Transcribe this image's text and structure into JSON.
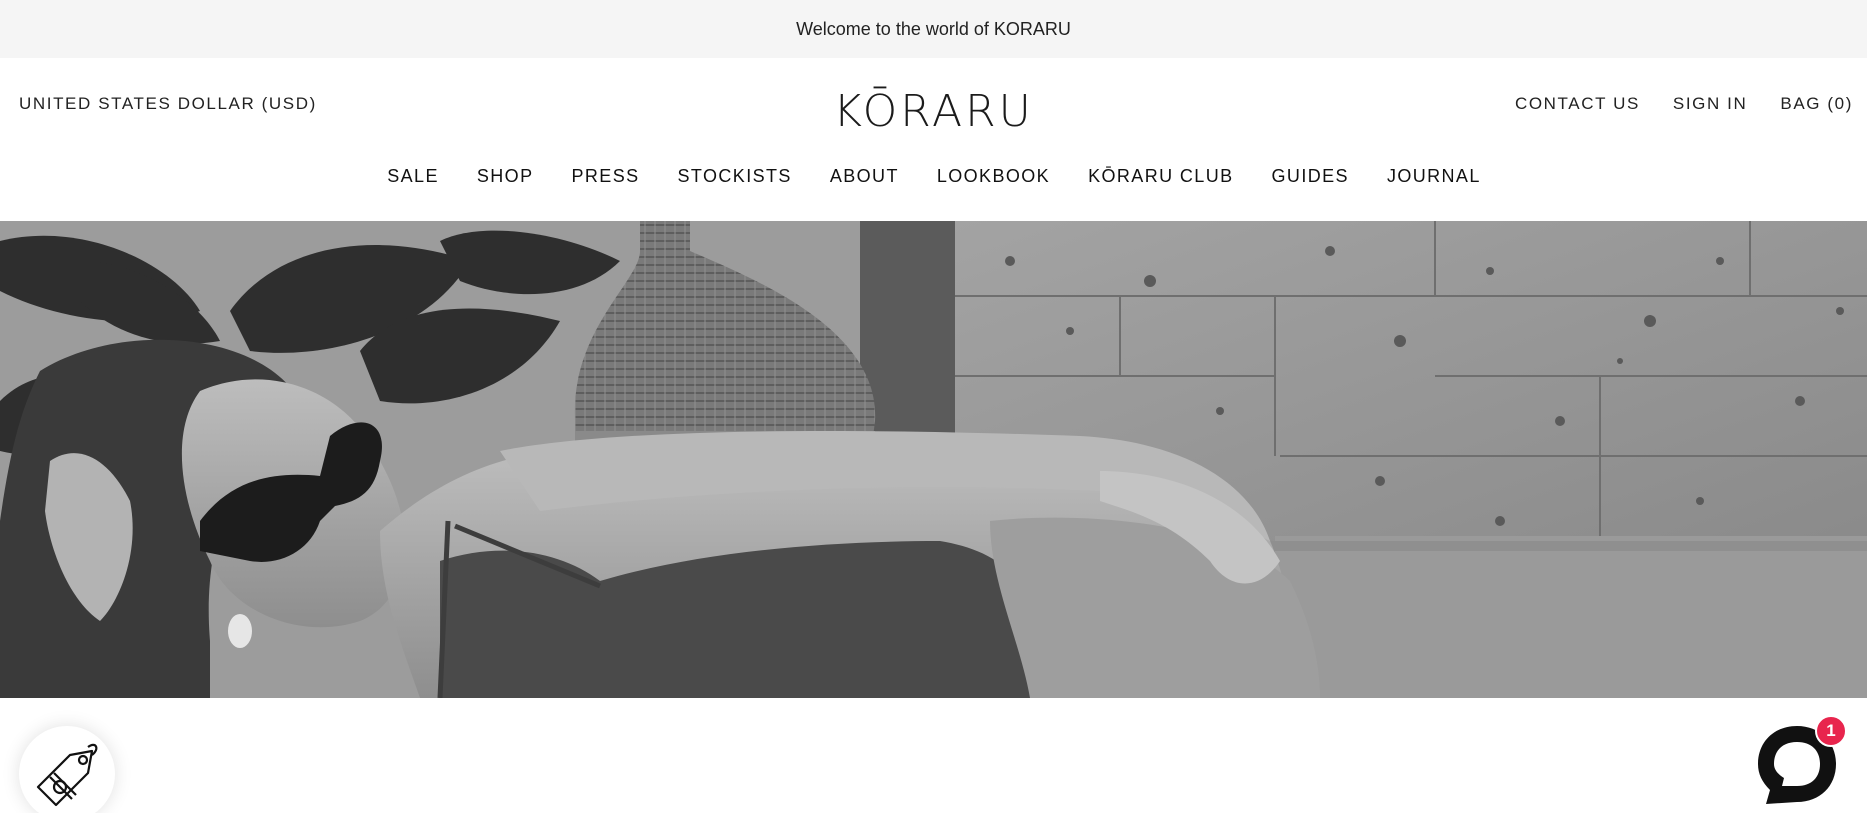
{
  "announcement": {
    "text": "Welcome to the world of KORARU"
  },
  "header": {
    "currency": "UNITED STATES DOLLAR (USD)",
    "logo": "KŌRARU",
    "utility_links": [
      "CONTACT US",
      "SIGN IN",
      "BAG (0)"
    ]
  },
  "nav": {
    "items": [
      "SALE",
      "SHOP",
      "PRESS",
      "STOCKISTS",
      "ABOUT",
      "LOOKBOOK",
      "KŌRARU CLUB",
      "GUIDES",
      "JOURNAL"
    ]
  },
  "hero": {
    "image": "black-and-white photo of woman in sunglasses and swimsuit reclining by stone wall"
  },
  "widgets": {
    "promo_icon": "price-tag-icon",
    "chat_icon": "chat-bubble-icon",
    "chat_badge": "1"
  },
  "colors": {
    "announcement_bg": "#f5f5f5",
    "badge": "#e8254d",
    "text": "#1a1a1a"
  }
}
